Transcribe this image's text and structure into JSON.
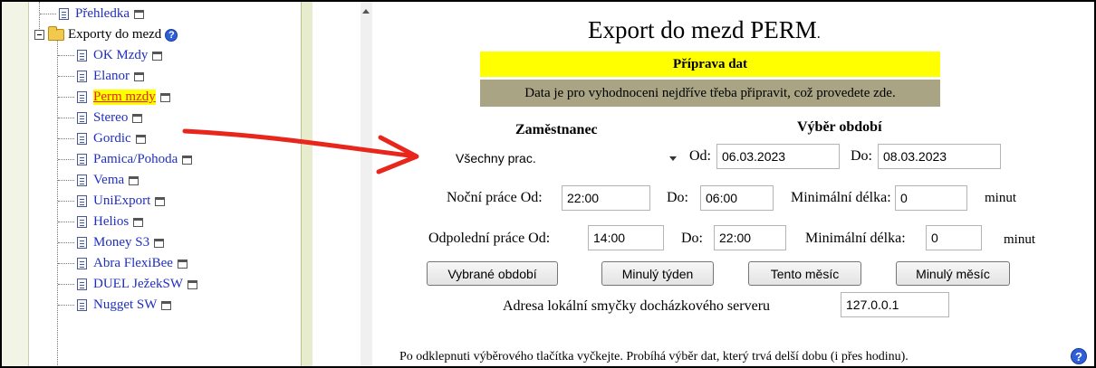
{
  "tree": {
    "items_top": [
      {
        "label": "Přehledka"
      }
    ],
    "folder": {
      "label": "Exporty do mezd",
      "help_glyph": "?"
    },
    "items": [
      {
        "label": "OK Mzdy"
      },
      {
        "label": "Elanor"
      },
      {
        "label": "Perm mzdy",
        "active": true
      },
      {
        "label": "Stereo"
      },
      {
        "label": "Gordic"
      },
      {
        "label": "Pamica/Pohoda"
      },
      {
        "label": "Vema"
      },
      {
        "label": "UniExport"
      },
      {
        "label": "Helios"
      },
      {
        "label": "Money S3"
      },
      {
        "label": "Abra FlexiBee"
      },
      {
        "label": "DUEL JežekSW"
      },
      {
        "label": "Nugget SW"
      }
    ]
  },
  "main": {
    "title": "Export do mezd PERM",
    "title_dot": ".",
    "prep_header": "Příprava dat",
    "prep_note": "Data je pro vyhodnoceni nejdříve třeba připravit, což provedete zde.",
    "employee_label": "Zaměstnanec",
    "period_label": "Výběr období",
    "employee_value": "Všechny prac.",
    "from_label": "Od:",
    "from_value": "06.03.2023",
    "to_label": "Do:",
    "to_value": "08.03.2023",
    "night": {
      "label": "Noční práce Od:",
      "from": "22:00",
      "to_label": "Do:",
      "to": "06:00",
      "min_label": "Minimální délka:",
      "min": "0",
      "unit": "minut"
    },
    "afternoon": {
      "label": "Odpolední práce Od:",
      "from": "14:00",
      "to_label": "Do:",
      "to": "22:00",
      "min_label": "Minimální délka:",
      "min": "0",
      "unit": "minut"
    },
    "buttons": {
      "selected_period": "Vybrané období",
      "last_week": "Minulý týden",
      "this_month": "Tento měsíc",
      "last_month": "Minulý měsíc"
    },
    "loopback_label": "Adresa lokální smyčky docházkového serveru",
    "loopback_value": "127.0.0.1",
    "footer_note": "Po odklepnuti výběrového tlačítka vyčkejte. Probíhá výběr dat, který trvá delší dobu (i přes hodinu).",
    "help_glyph": "?"
  },
  "colors": {
    "highlight": "#ffff00",
    "olive": "#a9a483",
    "link": "#1f2fbf",
    "active_link": "#e2261c",
    "arrow": "#e8261c"
  }
}
